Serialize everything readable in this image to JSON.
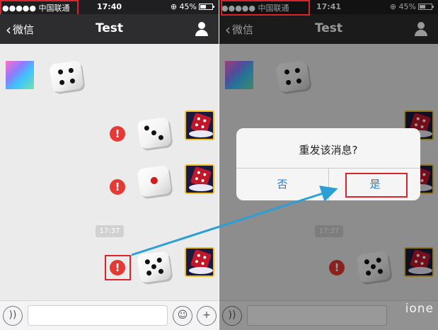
{
  "colors": {
    "status_bar_bg": "#1f1f21",
    "nav_bar_bg": "#2d2d30",
    "chat_bg": "#ebebeb",
    "error_red": "#e53935",
    "annotation_red": "#d9242a",
    "arrow_blue": "#2b9fd6",
    "ios_button_blue": "#1a7fd8"
  },
  "left_screen": {
    "status": {
      "carrier": "●●●●● 中国联通",
      "time": "17:40",
      "battery": "⊕ 45%"
    },
    "nav": {
      "back_label": "微信",
      "title": "Test",
      "contact_icon": "person-icon"
    },
    "messages": [
      {
        "side": "incoming",
        "type": "dice",
        "face": 4
      },
      {
        "side": "outgoing",
        "type": "dice",
        "face": 3,
        "error": true
      },
      {
        "side": "outgoing",
        "type": "dice",
        "face": 1,
        "error": true
      },
      {
        "side": "outgoing",
        "type": "dice",
        "face": 5,
        "error": true
      }
    ],
    "timestamp": "17:37",
    "input": {
      "voice_icon": "voice-icon",
      "placeholder": "",
      "emoji_icon": "emoji-icon",
      "plus_icon": "plus-icon"
    },
    "error_symbol": "!"
  },
  "right_screen": {
    "status": {
      "carrier": "●●●●● 中国联通",
      "time": "17:41",
      "battery": "⊕ 45%"
    },
    "nav": {
      "back_label": "微信",
      "title": "Test"
    },
    "timestamp": "17:37",
    "error_symbol": "!",
    "alert": {
      "message": "重发该消息?",
      "no_label": "否",
      "yes_label": "是"
    },
    "watermark": "ione"
  }
}
